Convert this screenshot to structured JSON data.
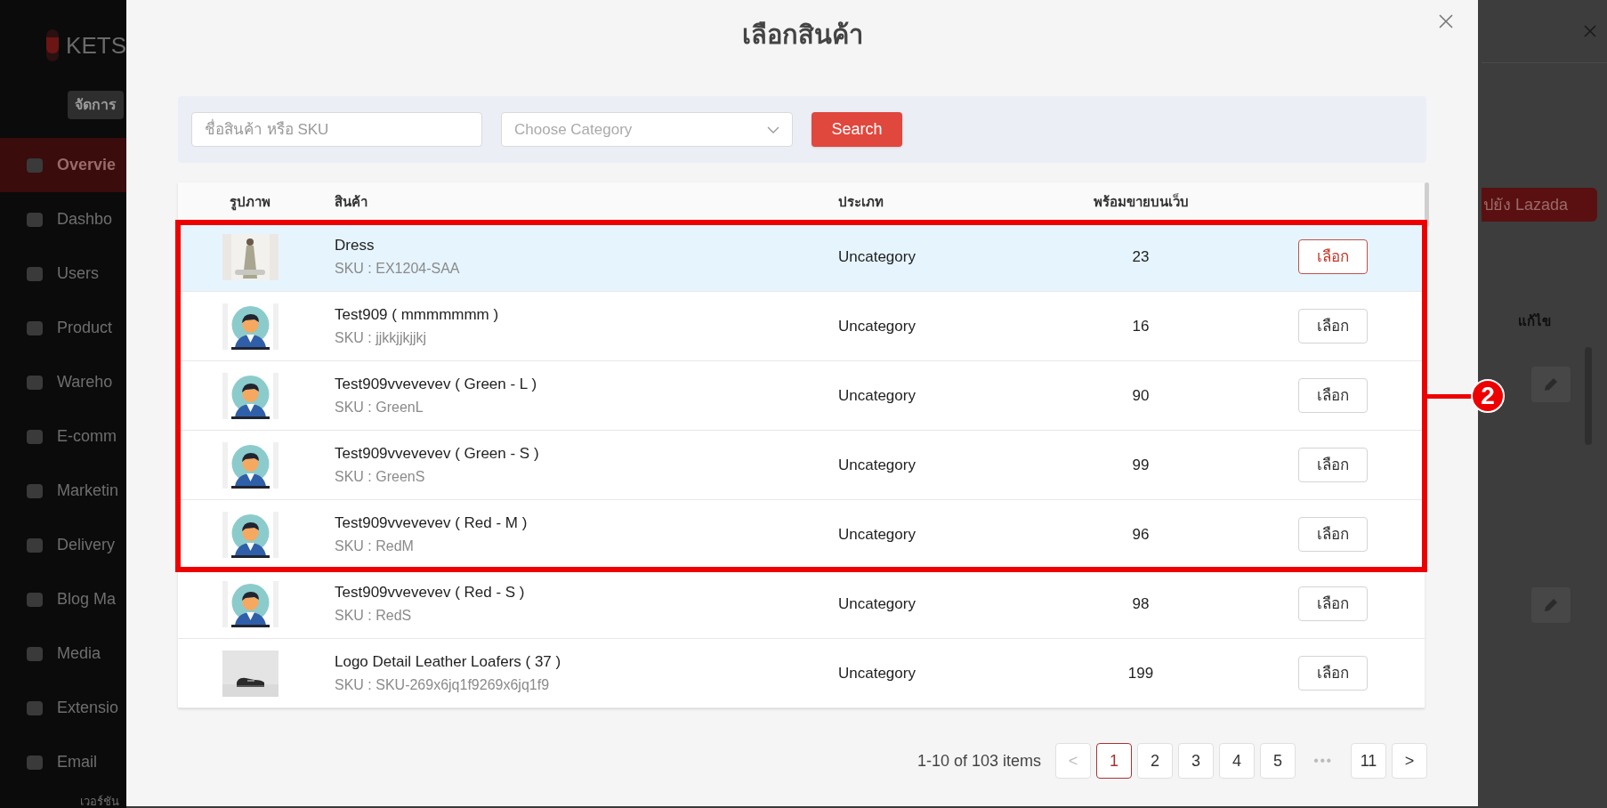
{
  "background": {
    "logo_text": "KETS",
    "manage_badge": "จัดการ",
    "sidebar": [
      {
        "label": "Overvie",
        "selected": true
      },
      {
        "label": "Dashbo",
        "selected": false
      },
      {
        "label": "Users",
        "selected": false
      },
      {
        "label": "Product",
        "selected": false
      },
      {
        "label": "Wareho",
        "selected": false
      },
      {
        "label": "E-comm",
        "selected": false
      },
      {
        "label": "Marketin",
        "selected": false
      },
      {
        "label": "Delivery",
        "selected": false
      },
      {
        "label": "Blog Ma",
        "selected": false
      },
      {
        "label": "Media",
        "selected": false
      },
      {
        "label": "Extensio",
        "selected": false
      },
      {
        "label": "Email",
        "selected": false
      }
    ],
    "version_text": "เวอร์ชัน",
    "lazada_button": "ปยัง Lazada",
    "edit_header": "แก้ไข"
  },
  "modal": {
    "title": "เลือกสินค้า",
    "search": {
      "placeholder": "ชื่อสินค้า หรือ SKU"
    },
    "category": {
      "placeholder": "Choose Category"
    },
    "search_button": "Search",
    "table": {
      "columns": [
        "รูปภาพ",
        "สินค้า",
        "ประเภท",
        "พร้อมขายบนเว็บ"
      ],
      "rows": [
        {
          "kind": "picture",
          "name": "Dress",
          "sku": "SKU : EX1204-SAA",
          "category": "Uncategory",
          "stock": "23",
          "action": "เลือก",
          "selected": true,
          "in_callout": true
        },
        {
          "kind": "avatar",
          "name": "Test909 ( mmmmmmm )",
          "sku": "SKU : jjkkjjkjjkj",
          "category": "Uncategory",
          "stock": "16",
          "action": "เลือก",
          "selected": false,
          "in_callout": true
        },
        {
          "kind": "avatar",
          "name": "Test909vvevevev ( Green - L )",
          "sku": "SKU : GreenL",
          "category": "Uncategory",
          "stock": "90",
          "action": "เลือก",
          "selected": false,
          "in_callout": true
        },
        {
          "kind": "avatar",
          "name": "Test909vvevevev ( Green - S )",
          "sku": "SKU : GreenS",
          "category": "Uncategory",
          "stock": "99",
          "action": "เลือก",
          "selected": false,
          "in_callout": true
        },
        {
          "kind": "avatar",
          "name": "Test909vvevevev ( Red - M )",
          "sku": "SKU : RedM",
          "category": "Uncategory",
          "stock": "96",
          "action": "เลือก",
          "selected": false,
          "in_callout": true
        },
        {
          "kind": "avatar",
          "name": "Test909vvevevev ( Red - S )",
          "sku": "SKU : RedS",
          "category": "Uncategory",
          "stock": "98",
          "action": "เลือก",
          "selected": false,
          "in_callout": false
        },
        {
          "kind": "picture",
          "name": "Logo Detail Leather Loafers ( 37 )",
          "sku": "SKU : SKU-269x6jq1f9269x6jq1f9",
          "category": "Uncategory",
          "stock": "199",
          "action": "เลือก",
          "selected": false,
          "in_callout": false
        }
      ]
    },
    "callout_label": "2",
    "pagination": {
      "summary": "1-10 of 103 items",
      "prev": "<",
      "next": ">",
      "ellipsis": "•••",
      "pages": [
        {
          "label": "1",
          "selected": true
        },
        {
          "label": "2",
          "selected": false
        },
        {
          "label": "3",
          "selected": false
        },
        {
          "label": "4",
          "selected": false
        },
        {
          "label": "5",
          "selected": false
        },
        {
          "label": "11",
          "selected": false
        }
      ]
    }
  }
}
